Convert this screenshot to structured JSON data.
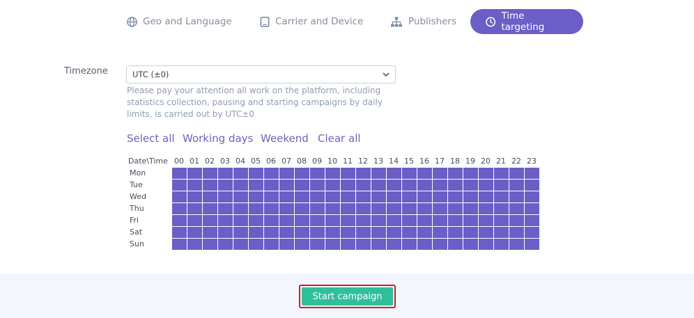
{
  "tabs": {
    "geo": "Geo and Language",
    "carrier": "Carrier and Device",
    "publishers": "Publishers",
    "time": "Time targeting"
  },
  "timezone": {
    "label": "Timezone",
    "value": "UTC (±0)",
    "note": "Please pay your attention all work on the platform, including statistics collection, pausing and starting campaigns by daily limits, is carried out by UTC±0"
  },
  "quick_select": {
    "select_all": "Select all",
    "working_days": "Working days",
    "weekend": "Weekend",
    "clear_all": "Clear all"
  },
  "schedule": {
    "corner_label": "Date\\Time",
    "hours": [
      "00",
      "01",
      "02",
      "03",
      "04",
      "05",
      "06",
      "07",
      "08",
      "09",
      "10",
      "11",
      "12",
      "13",
      "14",
      "15",
      "16",
      "17",
      "18",
      "19",
      "20",
      "21",
      "22",
      "23"
    ],
    "days": [
      "Mon",
      "Tue",
      "Wed",
      "Thu",
      "Fri",
      "Sat",
      "Sun"
    ],
    "all_selected": true,
    "selected_color": "#6b5ec7"
  },
  "footer": {
    "start_button": "Start campaign"
  },
  "colors": {
    "accent": "#6b5ec7",
    "start": "#2fbf9a",
    "highlight": "#d71920"
  }
}
